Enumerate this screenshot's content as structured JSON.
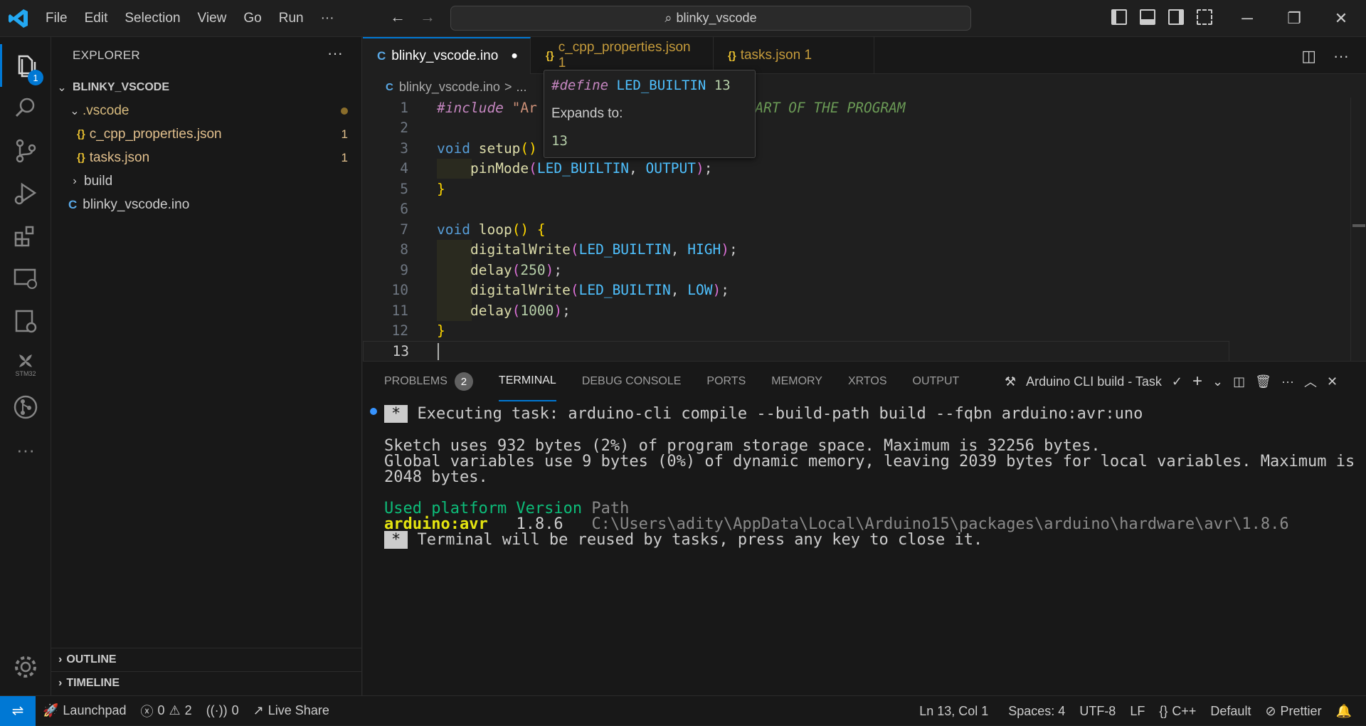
{
  "titlebar": {
    "menu": [
      "File",
      "Edit",
      "Selection",
      "View",
      "Go",
      "Run",
      "···"
    ],
    "search": "blinky_vscode"
  },
  "activity": {
    "explorer_badge": "1",
    "stm32_label": "STM32",
    "more": "···"
  },
  "sidebar": {
    "title": "EXPLORER",
    "more": "···",
    "root": "BLINKY_VSCODE",
    "items": [
      {
        "label": ".vscode"
      },
      {
        "label": "c_cpp_properties.json",
        "badge": "1"
      },
      {
        "label": "tasks.json",
        "badge": "1"
      },
      {
        "label": "build"
      },
      {
        "label": "blinky_vscode.ino"
      }
    ],
    "outline": "OUTLINE",
    "timeline": "TIMELINE"
  },
  "tabs": [
    {
      "label": "blinky_vscode.ino",
      "dirty": "●"
    },
    {
      "label": "c_cpp_properties.json 1"
    },
    {
      "label": "tasks.json 1"
    }
  ],
  "breadcrumb": {
    "file": "blinky_vscode.ino",
    "sep": ">",
    "more": "..."
  },
  "code": {
    "line_numbers": [
      "1",
      "2",
      "3",
      "4",
      "5",
      "6",
      "7",
      "8",
      "9",
      "10",
      "11",
      "12",
      "13"
    ],
    "include": "#include",
    "include_str": "\"Ar",
    "comment": "THE START OF THE PROGRAM"
  },
  "hover": {
    "define_kw": "#define",
    "define_name": "LED_BUILTIN",
    "define_val": "13",
    "expands": "Expands to:",
    "value": "13"
  },
  "panel": {
    "tabs": [
      {
        "label": "PROBLEMS",
        "badge": "2"
      },
      {
        "label": "TERMINAL"
      },
      {
        "label": "DEBUG CONSOLE"
      },
      {
        "label": "PORTS"
      },
      {
        "label": "MEMORY"
      },
      {
        "label": "XRTOS"
      },
      {
        "label": "OUTPUT"
      }
    ],
    "task": "Arduino CLI build - Task",
    "terminal": {
      "exec": "Executing task: arduino-cli compile --build-path build --fqbn arduino:avr:uno",
      "l1": "Sketch uses 932 bytes (2%) of program storage space. Maximum is 32256 bytes.",
      "l2": "Global variables use 9 bytes (0%) of dynamic memory, leaving 2039 bytes for local variables. Maximum is",
      "l3": "2048 bytes.",
      "hdr_a": "Used platform Version",
      "hdr_b": "Path",
      "plat": "arduino:avr",
      "ver": "1.8.6",
      "path": "C:\\Users\\adity\\AppData\\Local\\Arduino15\\packages\\arduino\\hardware\\avr\\1.8.6",
      "reuse": "Terminal will be reused by tasks, press any key to close it."
    }
  },
  "status": {
    "launchpad": "Launchpad",
    "errors": "0",
    "warnings": "2",
    "ports": "0",
    "liveshare": "Live Share",
    "position": "Ln 13, Col 1",
    "spaces": "Spaces: 4",
    "encoding": "UTF-8",
    "eol": "LF",
    "lang": "C++",
    "profile": "Default",
    "prettier": "Prettier"
  }
}
